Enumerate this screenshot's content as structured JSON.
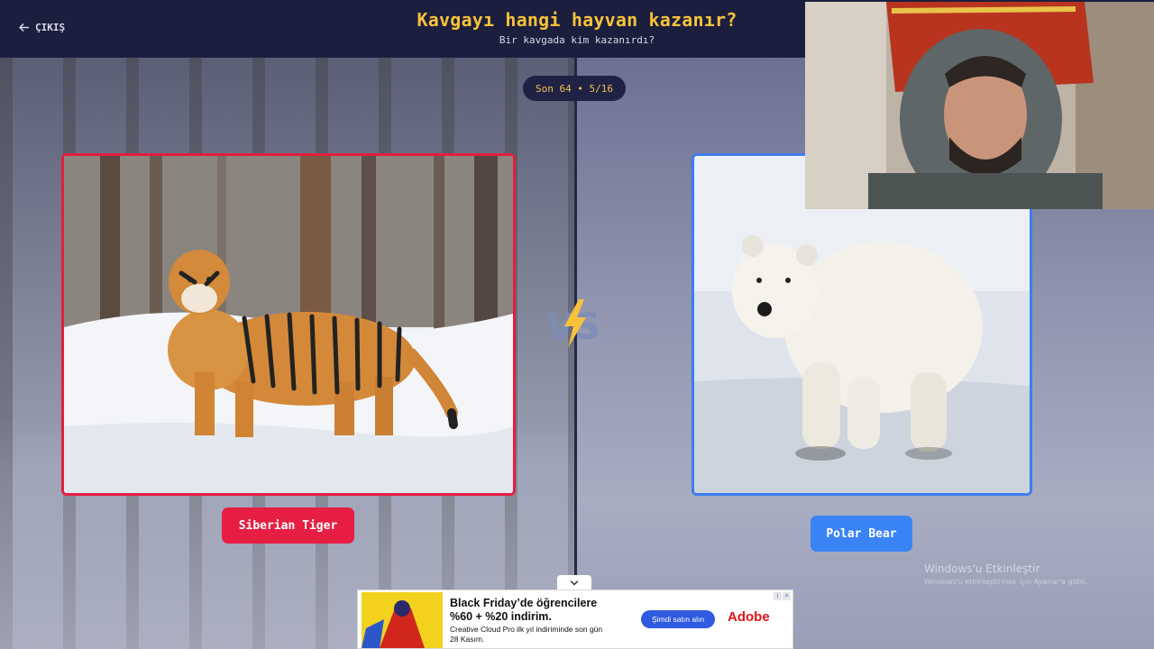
{
  "header": {
    "exit_label": "ÇIKIŞ",
    "title": "Kavgayı hangi hayvan kazanır?",
    "subtitle": "Bir kavgada kim kazanırdı?"
  },
  "round": {
    "label": "Son 64 • 5/16"
  },
  "left": {
    "name": "Siberian Tiger",
    "accent": "#e31e3f"
  },
  "right": {
    "name": "Polar Bear",
    "accent": "#3d7df0"
  },
  "vs": {
    "text": "VS"
  },
  "watermark": {
    "title": "Windows'u Etkinleştir",
    "subtitle": "Windows'u etkinleştirmek için Ayarlar'a gidin."
  },
  "ad": {
    "headline1": "Black Friday’de öğrencilere",
    "headline2": "%60 + %20 indirim.",
    "body": "Creative Cloud Pro ilk yıl indiriminde son gün 28 Kasım.",
    "cta": "Şimdi satın alın",
    "brand": "Adobe",
    "info_icon": "info-icon",
    "close_icon": "close-icon"
  },
  "colors": {
    "header_bg": "#1c1e3e",
    "title": "#f7c23a",
    "tiger_button": "#e61e43",
    "bear_button": "#3a83f4"
  }
}
